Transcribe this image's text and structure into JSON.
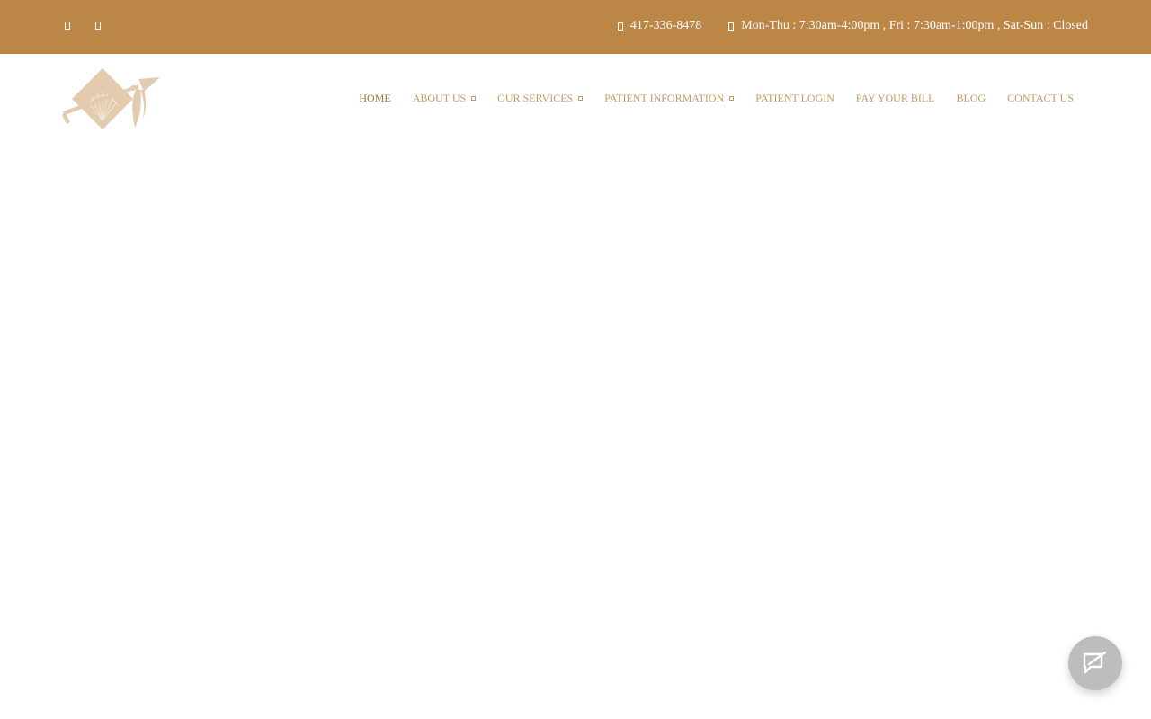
{
  "topbar": {
    "social": [
      {
        "icon": "facebook-icon"
      },
      {
        "icon": "twitter-icon"
      }
    ],
    "phone": "417-336-8478",
    "phone_icon": "phone-icon",
    "hours": "Mon-Thu : 7:30am-4:00pm , Fri : 7:30am-1:00pm , Sat-Sun : Closed",
    "hours_icon": "clock-icon",
    "background_color": "#bb8646"
  },
  "header": {
    "logo_icon": "arrowhead-diamond-logo",
    "nav": [
      {
        "label": "HOME",
        "active": true,
        "dropdown": false
      },
      {
        "label": "ABOUT US",
        "active": false,
        "dropdown": true
      },
      {
        "label": "OUR SERVICES",
        "active": false,
        "dropdown": true
      },
      {
        "label": "PATIENT INFORMATION",
        "active": false,
        "dropdown": true
      },
      {
        "label": "PATIENT LOGIN",
        "active": false,
        "dropdown": false
      },
      {
        "label": "PAY YOUR BILL",
        "active": false,
        "dropdown": false
      },
      {
        "label": "BLOG",
        "active": false,
        "dropdown": false
      },
      {
        "label": "CONTACT US",
        "active": false,
        "dropdown": false
      }
    ],
    "nav_color": "#c49a63",
    "nav_active_color": "#9c7446"
  },
  "chat": {
    "icon": "chat-bubble-icon",
    "color": "#bdbdbd"
  }
}
